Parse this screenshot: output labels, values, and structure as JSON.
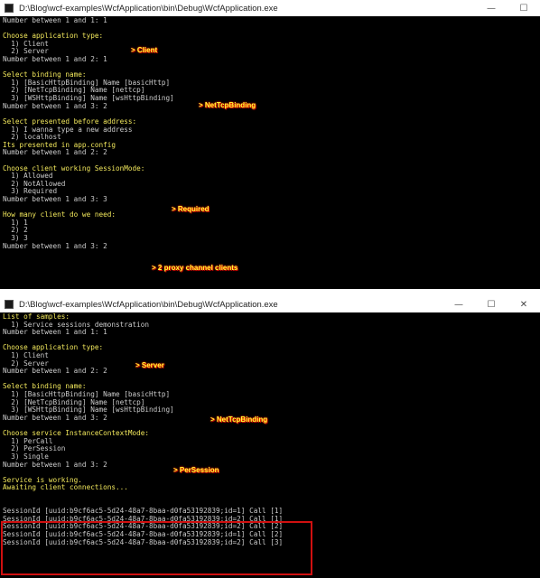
{
  "window1": {
    "title": "D:\\Blog\\wcf-examples\\WcfApplication\\bin\\Debug\\WcfApplication.exe",
    "controls": [
      "—",
      "☐"
    ],
    "lines": [
      {
        "text": "Number between 1 and 1: 1",
        "color": "w"
      },
      {
        "text": "",
        "color": "w"
      },
      {
        "text": "Choose application type:",
        "color": "y"
      },
      {
        "text": "  1) Client",
        "color": "w"
      },
      {
        "text": "  2) Server",
        "color": "w"
      },
      {
        "text": "Number between 1 and 2: 1",
        "color": "w"
      },
      {
        "text": "",
        "color": "w"
      },
      {
        "text": "Select binding name:",
        "color": "y"
      },
      {
        "text": "  1) [BasicHttpBinding] Name [basicHttp]",
        "color": "w"
      },
      {
        "text": "  2) [NetTcpBinding] Name [nettcp]",
        "color": "w"
      },
      {
        "text": "  3) [WSHttpBinding] Name [wsHttpBinding]",
        "color": "w"
      },
      {
        "text": "Number between 1 and 3: 2",
        "color": "w"
      },
      {
        "text": "",
        "color": "w"
      },
      {
        "text": "Select presented before address:",
        "color": "y"
      },
      {
        "text": "  1) I wanna type a new address",
        "color": "w"
      },
      {
        "text": "  2) localhost",
        "color": "w"
      },
      {
        "text": "Its presented in app.config",
        "color": "y"
      },
      {
        "text": "Number between 1 and 2: 2",
        "color": "w"
      },
      {
        "text": "",
        "color": "w"
      },
      {
        "text": "Choose client working SessionMode:",
        "color": "y"
      },
      {
        "text": "  1) Allowed",
        "color": "w"
      },
      {
        "text": "  2) NotAllowed",
        "color": "w"
      },
      {
        "text": "  3) Required",
        "color": "w"
      },
      {
        "text": "Number between 1 and 3: 3",
        "color": "w"
      },
      {
        "text": "",
        "color": "w"
      },
      {
        "text": "How many client do we need:",
        "color": "y"
      },
      {
        "text": "  1) 1",
        "color": "w"
      },
      {
        "text": "  2) 2",
        "color": "w"
      },
      {
        "text": "  3) 3",
        "color": "w"
      },
      {
        "text": "Number between 1 and 3: 2",
        "color": "w"
      }
    ],
    "annotations": [
      "> Client",
      "> NetTcpBinding",
      "> Required",
      "> 2 proxy channel clients"
    ]
  },
  "window2": {
    "title": "D:\\Blog\\wcf-examples\\WcfApplication\\bin\\Debug\\WcfApplication.exe",
    "controls": [
      "—",
      "☐",
      "✕"
    ],
    "lines": [
      {
        "text": "List of samples:",
        "color": "y"
      },
      {
        "text": "  1) Service sessions demonstration",
        "color": "w"
      },
      {
        "text": "Number between 1 and 1: 1",
        "color": "w"
      },
      {
        "text": "",
        "color": "w"
      },
      {
        "text": "Choose application type:",
        "color": "y"
      },
      {
        "text": "  1) Client",
        "color": "w"
      },
      {
        "text": "  2) Server",
        "color": "w"
      },
      {
        "text": "Number between 1 and 2: 2",
        "color": "w"
      },
      {
        "text": "",
        "color": "w"
      },
      {
        "text": "Select binding name:",
        "color": "y"
      },
      {
        "text": "  1) [BasicHttpBinding] Name [basicHttp]",
        "color": "w"
      },
      {
        "text": "  2) [NetTcpBinding] Name [nettcp]",
        "color": "w"
      },
      {
        "text": "  3) [WSHttpBinding] Name [wsHttpBinding]",
        "color": "w"
      },
      {
        "text": "Number between 1 and 3: 2",
        "color": "w"
      },
      {
        "text": "",
        "color": "w"
      },
      {
        "text": "Choose service InstanceContextMode:",
        "color": "y"
      },
      {
        "text": "  1) PerCall",
        "color": "w"
      },
      {
        "text": "  2) PerSession",
        "color": "w"
      },
      {
        "text": "  3) Single",
        "color": "w"
      },
      {
        "text": "Number between 1 and 3: 2",
        "color": "w"
      },
      {
        "text": "",
        "color": "w"
      },
      {
        "text": "Service is working.",
        "color": "y"
      },
      {
        "text": "Awaiting client connections...",
        "color": "y"
      },
      {
        "text": "",
        "color": "w"
      },
      {
        "text": "",
        "color": "w"
      },
      {
        "text": "SessionId [uuid:b9cf6ac5-5d24-48a7-8baa-d0fa53192839;id=1] Call [1]",
        "color": "w"
      },
      {
        "text": "SessionId [uuid:b9cf6ac5-5d24-48a7-8baa-d0fa53192839;id=2] Call [1]",
        "color": "w"
      },
      {
        "text": "SessionId [uuid:b9cf6ac5-5d24-48a7-8baa-d0fa53192839;id=2] Call [2]",
        "color": "w"
      },
      {
        "text": "SessionId [uuid:b9cf6ac5-5d24-48a7-8baa-d0fa53192839;id=1] Call [2]",
        "color": "w"
      },
      {
        "text": "SessionId [uuid:b9cf6ac5-5d24-48a7-8baa-d0fa53192839;id=2] Call [3]",
        "color": "w"
      }
    ],
    "annotations": [
      "> Server",
      "> NetTcpBinding",
      "> PerSession"
    ]
  },
  "colors": {
    "console_bg": "#000000",
    "console_text": "#cccccc",
    "prompt_yellow": "#f2e85c",
    "annotation": "#ffff33",
    "highlight_box": "#d01010"
  }
}
